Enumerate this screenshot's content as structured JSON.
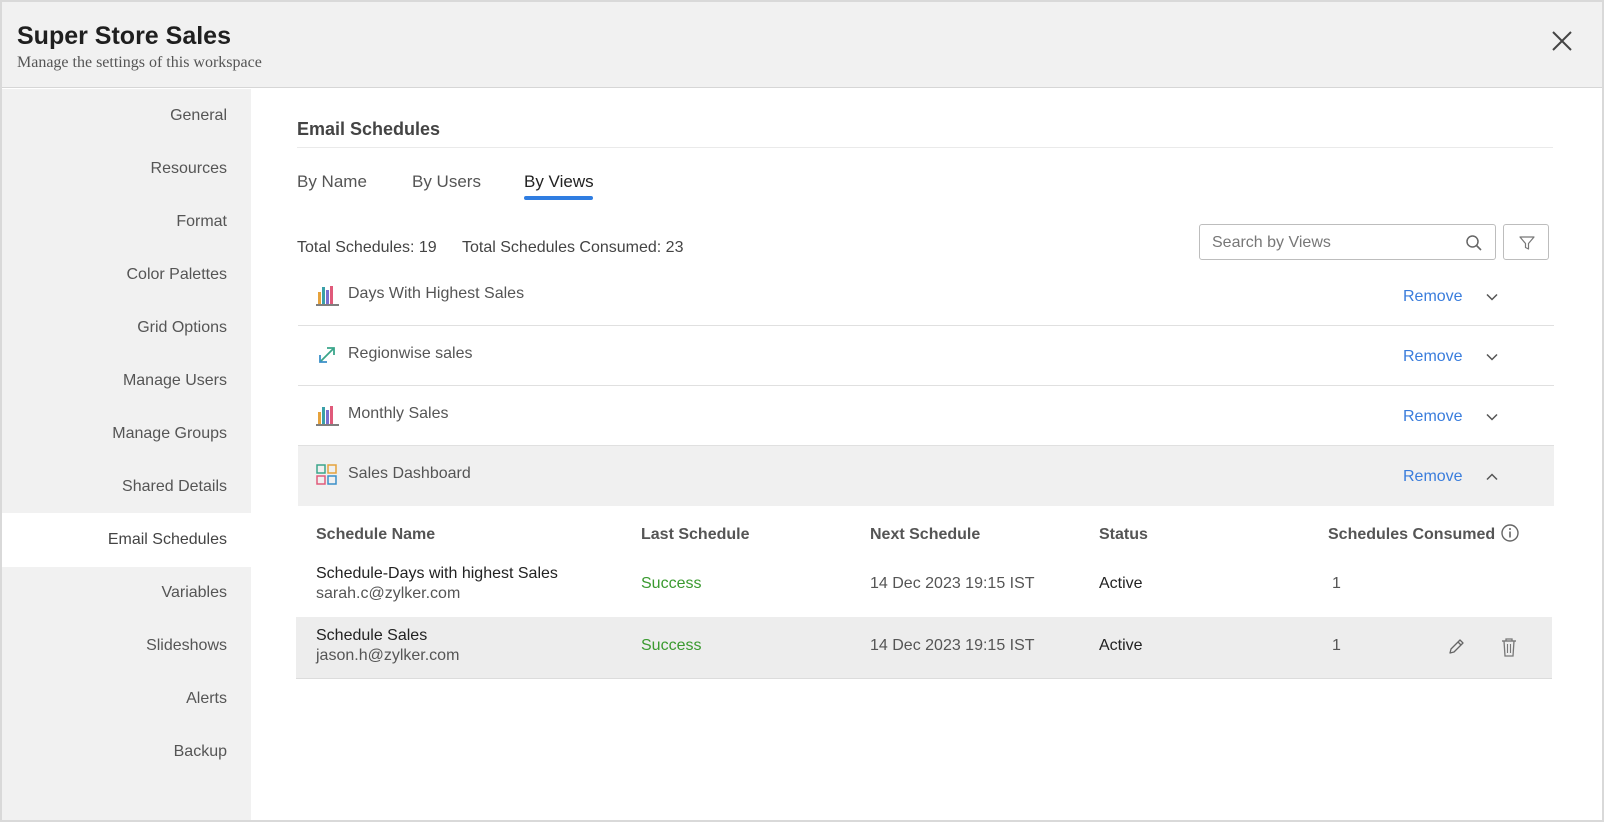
{
  "header": {
    "title": "Super Store Sales",
    "subtitle": "Manage the settings of this workspace"
  },
  "sidebar": {
    "items": [
      {
        "label": "General"
      },
      {
        "label": "Resources"
      },
      {
        "label": "Format"
      },
      {
        "label": "Color Palettes"
      },
      {
        "label": "Grid Options"
      },
      {
        "label": "Manage Users"
      },
      {
        "label": "Manage Groups"
      },
      {
        "label": "Shared Details"
      },
      {
        "label": "Email Schedules",
        "active": true
      },
      {
        "label": "Variables"
      },
      {
        "label": "Slideshows"
      },
      {
        "label": "Alerts"
      },
      {
        "label": "Backup"
      }
    ]
  },
  "main": {
    "section_title": "Email Schedules",
    "tabs": [
      {
        "label": "By Name"
      },
      {
        "label": "By Users"
      },
      {
        "label": "By Views",
        "active": true
      }
    ],
    "total_schedules": "Total Schedules: 19",
    "total_consumed": "Total Schedules Consumed: 23",
    "search_placeholder": "Search by Views",
    "remove_label": "Remove",
    "views": [
      {
        "name": "Days With Highest Sales",
        "icon": "bar-chart-icon",
        "expanded": false
      },
      {
        "name": "Regionwise sales",
        "icon": "expand-arrows-icon",
        "expanded": false
      },
      {
        "name": "Monthly Sales",
        "icon": "bar-chart-icon",
        "expanded": false
      },
      {
        "name": "Sales Dashboard",
        "icon": "dashboard-grid-icon",
        "expanded": true
      }
    ],
    "table": {
      "headers": [
        "Schedule Name",
        "Last Schedule",
        "Next Schedule",
        "Status",
        "Schedules Consumed"
      ],
      "rows": [
        {
          "name": "Schedule-Days with highest Sales",
          "email": "sarah.c@zylker.com",
          "last": "Success",
          "next": "14 Dec 2023 19:15 IST",
          "status": "Active",
          "consumed": "1"
        },
        {
          "name": "Schedule Sales",
          "email": "jason.h@zylker.com",
          "last": "Success",
          "next": "14 Dec 2023 19:15 IST",
          "status": "Active",
          "consumed": "1"
        }
      ]
    }
  },
  "colors": {
    "accent": "#2f7de1",
    "link": "#3a7ddc",
    "success": "#3a9a2f",
    "sidebar_bg": "#f1f1f1"
  }
}
